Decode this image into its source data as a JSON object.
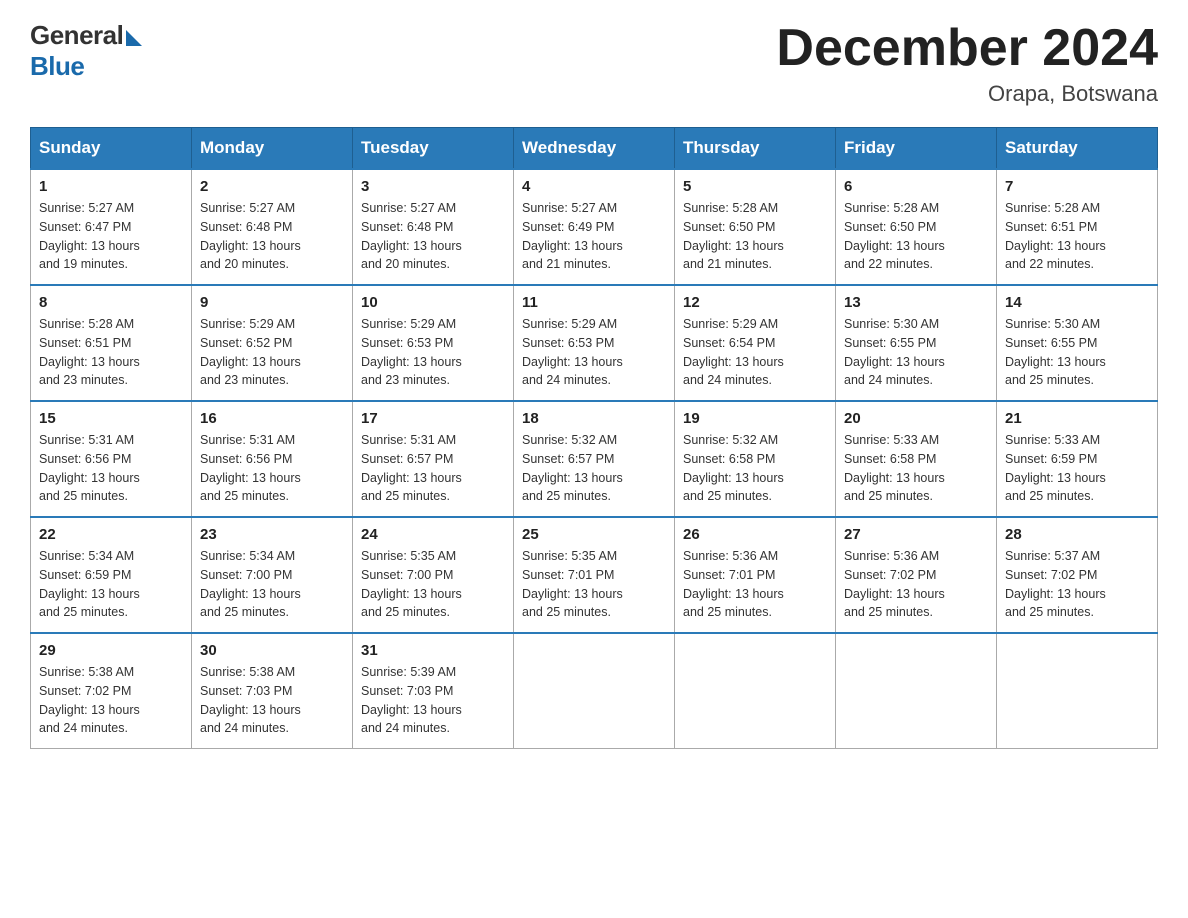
{
  "header": {
    "logo_general": "General",
    "logo_blue": "Blue",
    "month_title": "December 2024",
    "location": "Orapa, Botswana"
  },
  "days_of_week": [
    "Sunday",
    "Monday",
    "Tuesday",
    "Wednesday",
    "Thursday",
    "Friday",
    "Saturday"
  ],
  "weeks": [
    [
      {
        "day": "1",
        "sunrise": "5:27 AM",
        "sunset": "6:47 PM",
        "daylight": "13 hours and 19 minutes."
      },
      {
        "day": "2",
        "sunrise": "5:27 AM",
        "sunset": "6:48 PM",
        "daylight": "13 hours and 20 minutes."
      },
      {
        "day": "3",
        "sunrise": "5:27 AM",
        "sunset": "6:48 PM",
        "daylight": "13 hours and 20 minutes."
      },
      {
        "day": "4",
        "sunrise": "5:27 AM",
        "sunset": "6:49 PM",
        "daylight": "13 hours and 21 minutes."
      },
      {
        "day": "5",
        "sunrise": "5:28 AM",
        "sunset": "6:50 PM",
        "daylight": "13 hours and 21 minutes."
      },
      {
        "day": "6",
        "sunrise": "5:28 AM",
        "sunset": "6:50 PM",
        "daylight": "13 hours and 22 minutes."
      },
      {
        "day": "7",
        "sunrise": "5:28 AM",
        "sunset": "6:51 PM",
        "daylight": "13 hours and 22 minutes."
      }
    ],
    [
      {
        "day": "8",
        "sunrise": "5:28 AM",
        "sunset": "6:51 PM",
        "daylight": "13 hours and 23 minutes."
      },
      {
        "day": "9",
        "sunrise": "5:29 AM",
        "sunset": "6:52 PM",
        "daylight": "13 hours and 23 minutes."
      },
      {
        "day": "10",
        "sunrise": "5:29 AM",
        "sunset": "6:53 PM",
        "daylight": "13 hours and 23 minutes."
      },
      {
        "day": "11",
        "sunrise": "5:29 AM",
        "sunset": "6:53 PM",
        "daylight": "13 hours and 24 minutes."
      },
      {
        "day": "12",
        "sunrise": "5:29 AM",
        "sunset": "6:54 PM",
        "daylight": "13 hours and 24 minutes."
      },
      {
        "day": "13",
        "sunrise": "5:30 AM",
        "sunset": "6:55 PM",
        "daylight": "13 hours and 24 minutes."
      },
      {
        "day": "14",
        "sunrise": "5:30 AM",
        "sunset": "6:55 PM",
        "daylight": "13 hours and 25 minutes."
      }
    ],
    [
      {
        "day": "15",
        "sunrise": "5:31 AM",
        "sunset": "6:56 PM",
        "daylight": "13 hours and 25 minutes."
      },
      {
        "day": "16",
        "sunrise": "5:31 AM",
        "sunset": "6:56 PM",
        "daylight": "13 hours and 25 minutes."
      },
      {
        "day": "17",
        "sunrise": "5:31 AM",
        "sunset": "6:57 PM",
        "daylight": "13 hours and 25 minutes."
      },
      {
        "day": "18",
        "sunrise": "5:32 AM",
        "sunset": "6:57 PM",
        "daylight": "13 hours and 25 minutes."
      },
      {
        "day": "19",
        "sunrise": "5:32 AM",
        "sunset": "6:58 PM",
        "daylight": "13 hours and 25 minutes."
      },
      {
        "day": "20",
        "sunrise": "5:33 AM",
        "sunset": "6:58 PM",
        "daylight": "13 hours and 25 minutes."
      },
      {
        "day": "21",
        "sunrise": "5:33 AM",
        "sunset": "6:59 PM",
        "daylight": "13 hours and 25 minutes."
      }
    ],
    [
      {
        "day": "22",
        "sunrise": "5:34 AM",
        "sunset": "6:59 PM",
        "daylight": "13 hours and 25 minutes."
      },
      {
        "day": "23",
        "sunrise": "5:34 AM",
        "sunset": "7:00 PM",
        "daylight": "13 hours and 25 minutes."
      },
      {
        "day": "24",
        "sunrise": "5:35 AM",
        "sunset": "7:00 PM",
        "daylight": "13 hours and 25 minutes."
      },
      {
        "day": "25",
        "sunrise": "5:35 AM",
        "sunset": "7:01 PM",
        "daylight": "13 hours and 25 minutes."
      },
      {
        "day": "26",
        "sunrise": "5:36 AM",
        "sunset": "7:01 PM",
        "daylight": "13 hours and 25 minutes."
      },
      {
        "day": "27",
        "sunrise": "5:36 AM",
        "sunset": "7:02 PM",
        "daylight": "13 hours and 25 minutes."
      },
      {
        "day": "28",
        "sunrise": "5:37 AM",
        "sunset": "7:02 PM",
        "daylight": "13 hours and 25 minutes."
      }
    ],
    [
      {
        "day": "29",
        "sunrise": "5:38 AM",
        "sunset": "7:02 PM",
        "daylight": "13 hours and 24 minutes."
      },
      {
        "day": "30",
        "sunrise": "5:38 AM",
        "sunset": "7:03 PM",
        "daylight": "13 hours and 24 minutes."
      },
      {
        "day": "31",
        "sunrise": "5:39 AM",
        "sunset": "7:03 PM",
        "daylight": "13 hours and 24 minutes."
      },
      null,
      null,
      null,
      null
    ]
  ],
  "labels": {
    "sunrise_prefix": "Sunrise: ",
    "sunset_prefix": "Sunset: ",
    "daylight_prefix": "Daylight: "
  }
}
